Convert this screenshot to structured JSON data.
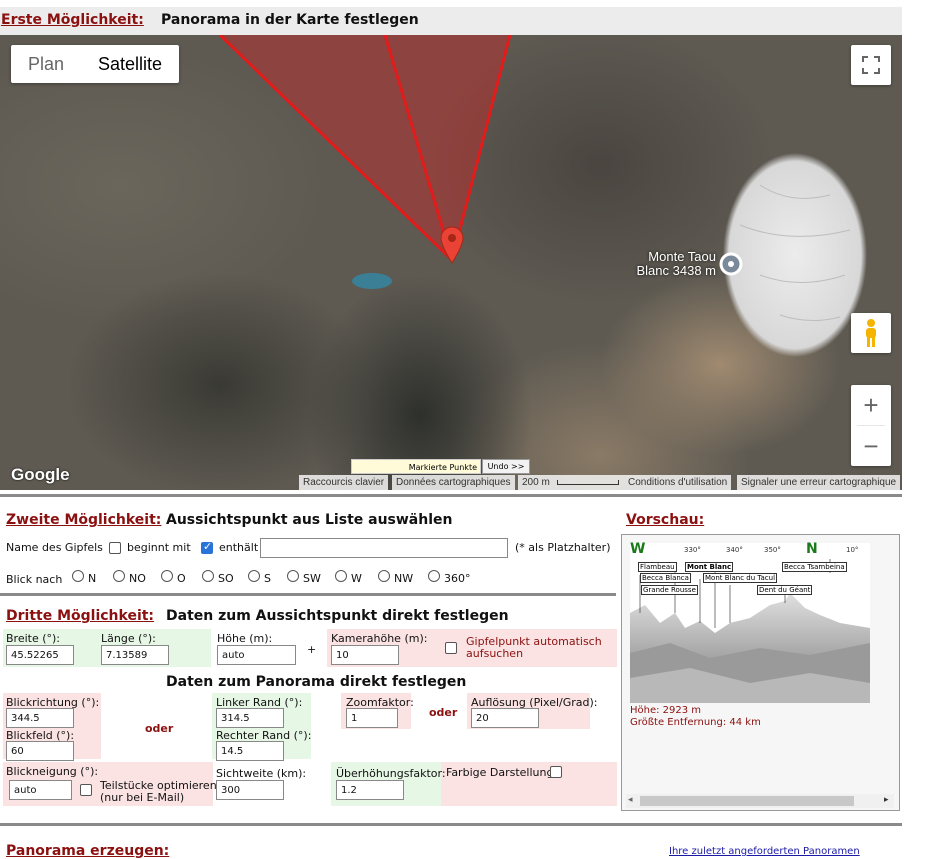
{
  "section1": {
    "label": "Erste Möglichkeit:",
    "title": "Panorama in der Karte festlegen"
  },
  "map": {
    "toggle_plan": "Plan",
    "toggle_satellite": "Satellite",
    "peak_label_line1": "Monte Taou",
    "peak_label_line2": "Blanc 3438 m",
    "google": "Google",
    "marked_points": "Markierte Punkte",
    "undo": "Undo >>",
    "attr_shortcuts": "Raccourcis clavier",
    "attr_data": "Données cartographiques",
    "attr_scale": "200 m",
    "attr_terms": "Conditions d'utilisation",
    "attr_report": "Signaler une erreur cartographique",
    "zoom_in": "+",
    "zoom_out": "−",
    "icons": [
      "fullscreen-icon",
      "pegman-icon",
      "location-pin-icon",
      "peak-marker-icon"
    ]
  },
  "section2": {
    "label": "Zweite Möglichkeit:",
    "title": "Aussichtspunkt aus Liste auswählen",
    "name_label": "Name des Gipfels",
    "begins_with": "beginnt mit",
    "contains": "enthält",
    "search_value": "",
    "wildcard_hint": "(* als Platzhalter)",
    "look_label": "Blick nach",
    "directions": [
      "N",
      "NO",
      "O",
      "SO",
      "S",
      "SW",
      "W",
      "NW",
      "360°"
    ]
  },
  "preview": {
    "label": "Vorschau:",
    "compass_left": "W",
    "compass_n": "N",
    "ticks": [
      "330°",
      "340°",
      "350°",
      "10°"
    ],
    "peaks": [
      "Flambeau",
      "Mont Blanc",
      "Becca Tsambeina",
      "Becca Blanca",
      "Mont Blanc du Tacul",
      "Grande Rousse",
      "Dent du Géant"
    ],
    "height": "Höhe: 2923 m",
    "distance": "Größte Entfernung: 44 km"
  },
  "section3": {
    "label": "Dritte Möglichkeit:",
    "title": "Daten zum Aussichtspunkt direkt festlegen",
    "lat_label": "Breite (°):",
    "lat_value": "45.52265",
    "lon_label": "Länge (°):",
    "lon_value": "7.13589",
    "height_label": "Höhe (m):",
    "height_value": "auto",
    "plus": "+",
    "cam_label": "Kamerahöhe (m):",
    "cam_value": "10",
    "auto_peak": "Gipfelpunkt automatisch aufsuchen",
    "pano_title": "Daten zum Panorama direkt festlegen",
    "dir_label": "Blickrichtung (°):",
    "dir_value": "344.5",
    "fov_label": "Blickfeld (°):",
    "fov_value": "60",
    "oder": "oder",
    "left_label": "Linker Rand (°):",
    "left_value": "314.5",
    "right_label": "Rechter Rand (°):",
    "right_value": "14.5",
    "zoom_label": "Zoomfaktor:",
    "zoom_value": "1",
    "res_label": "Auflösung (Pixel/Grad):",
    "res_value": "20",
    "tilt_label": "Blickneigung (°):",
    "tilt_value": "auto",
    "optimize": "Teilstücke optimieren",
    "optimize2": "(nur bei E-Mail)",
    "range_label": "Sichtweite (km):",
    "range_value": "300",
    "exag_label": "Überhöhungsfaktor:",
    "exag_value": "1.2",
    "color_label": "Farbige Darstellung:"
  },
  "section4": {
    "label": "Panorama erzeugen:",
    "recent": "Ihre zuletzt angeforderten Panoramen"
  }
}
